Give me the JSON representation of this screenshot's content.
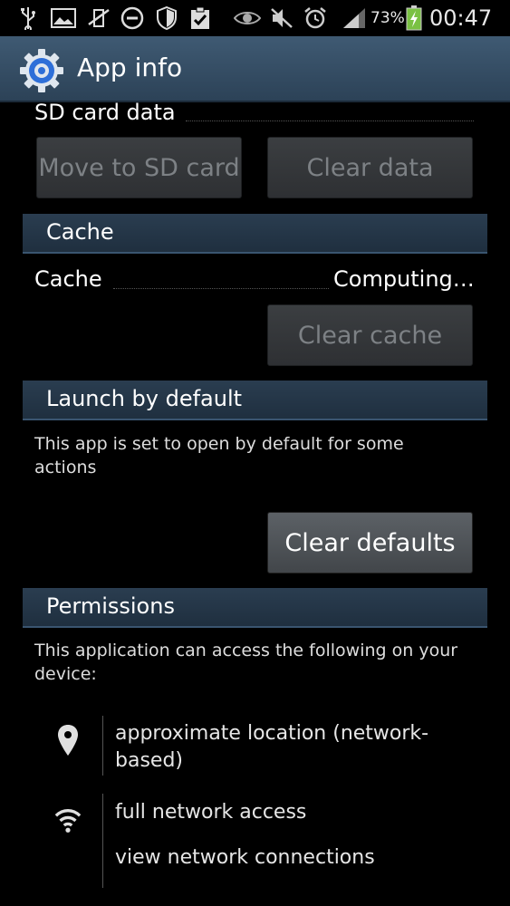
{
  "status_bar": {
    "battery_pct": "73%",
    "time": "00:47",
    "icons": [
      "usb-icon",
      "gallery-icon",
      "no-vibrate-icon",
      "do-not-disturb-icon",
      "shield-icon",
      "clipboard-check-icon",
      "eye-icon",
      "mute-icon",
      "alarm-icon",
      "signal-icon",
      "battery-charging-icon"
    ]
  },
  "action_bar": {
    "title": "App info"
  },
  "storage": {
    "sd_card_label": "SD card data",
    "move_button": "Move to SD card",
    "clear_data_button": "Clear data"
  },
  "cache": {
    "header": "Cache",
    "label": "Cache",
    "value": "Computing…",
    "clear_button": "Clear cache"
  },
  "launch": {
    "header": "Launch by default",
    "description": "This app is set to open by default for some actions",
    "clear_button": "Clear defaults"
  },
  "permissions": {
    "header": "Permissions",
    "description": "This application can access the following on your device:",
    "groups": [
      {
        "icon": "location-pin-icon",
        "items": [
          "approximate location (network-based)"
        ]
      },
      {
        "icon": "wifi-icon",
        "items": [
          "full network access",
          "view network connections"
        ]
      }
    ]
  },
  "colors": {
    "accent": "#3a5570",
    "section_bg": "#24364a"
  }
}
